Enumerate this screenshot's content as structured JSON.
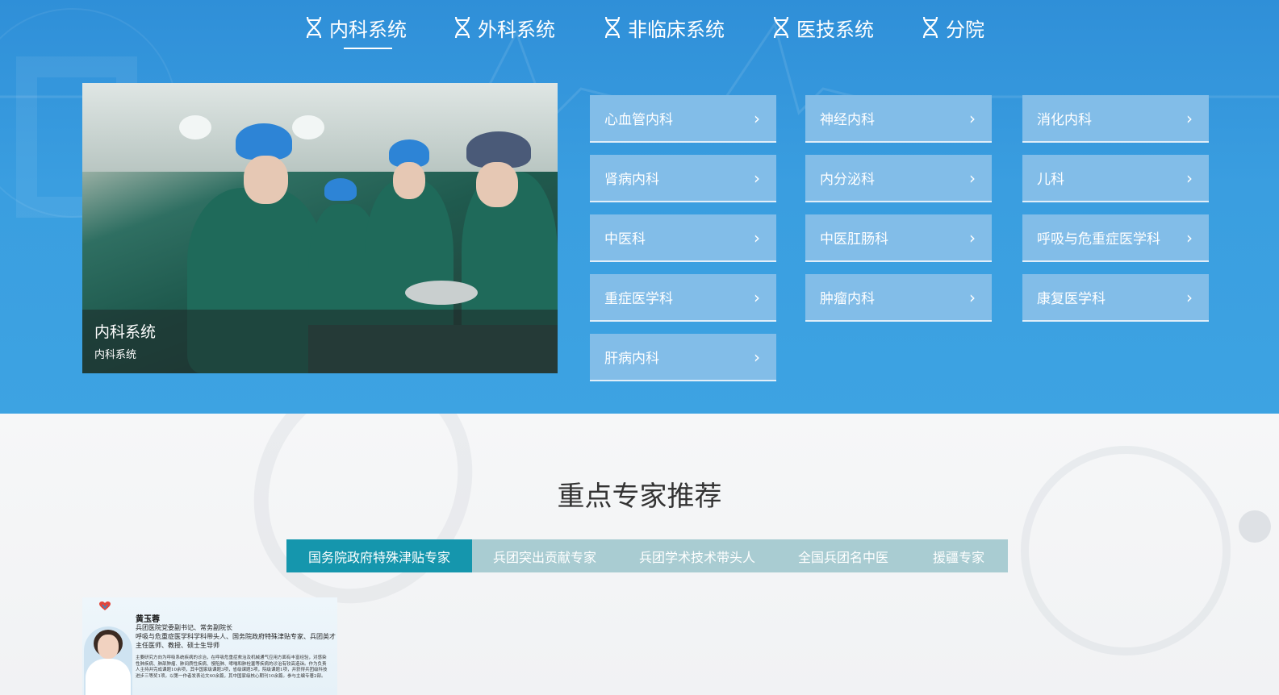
{
  "nav": {
    "tabs": [
      {
        "label": "内科系统",
        "active": true,
        "icon": "dna-icon"
      },
      {
        "label": "外科系统",
        "active": false,
        "icon": "dna-icon"
      },
      {
        "label": "非临床系统",
        "active": false,
        "icon": "dna-icon"
      },
      {
        "label": "医技系统",
        "active": false,
        "icon": "dna-icon"
      },
      {
        "label": "分院",
        "active": false,
        "icon": "dna-icon"
      }
    ]
  },
  "feature": {
    "caption_title": "内科系统",
    "caption_sub": "内科系统"
  },
  "departments": [
    {
      "label": "心血管内科",
      "icon": "chevron-right-icon"
    },
    {
      "label": "神经内科",
      "icon": "chevron-right-icon"
    },
    {
      "label": "消化内科",
      "icon": "chevron-right-icon"
    },
    {
      "label": "肾病内科",
      "icon": "chevron-right-icon"
    },
    {
      "label": "内分泌科",
      "icon": "chevron-right-icon"
    },
    {
      "label": "儿科",
      "icon": "chevron-right-icon"
    },
    {
      "label": "中医科",
      "icon": "chevron-right-icon"
    },
    {
      "label": "中医肛肠科",
      "icon": "chevron-right-icon"
    },
    {
      "label": "呼吸与危重症医学科",
      "icon": "chevron-right-icon"
    },
    {
      "label": "重症医学科",
      "icon": "chevron-right-icon"
    },
    {
      "label": "肿瘤内科",
      "icon": "chevron-right-icon"
    },
    {
      "label": "康复医学科",
      "icon": "chevron-right-icon"
    },
    {
      "label": "肝病内科",
      "icon": "chevron-right-icon"
    }
  ],
  "chevron_glyph": "›",
  "experts": {
    "title": "重点专家推荐",
    "tabs": [
      {
        "label": "国务院政府特殊津贴专家",
        "active": true
      },
      {
        "label": "兵团突出贡献专家",
        "active": false
      },
      {
        "label": "兵团学术技术带头人",
        "active": false
      },
      {
        "label": "全国兵团名中医",
        "active": false
      },
      {
        "label": "援疆专家",
        "active": false
      }
    ],
    "card": {
      "name": "黄玉蓉",
      "line1": "兵团医院党委副书记、常务副院长",
      "line2": "呼吸与危重症医学科学科带头人、国务院政府特殊津贴专家、兵团英才",
      "line3": "主任医师、教授、硕士生导师",
      "bio": "主要研究方向为呼吸系统疾病的诊治，在呼吸危重症救治及机械通气应用方面有丰富经验，对感染性肺疾病、肺部肿瘤、肺间质性疾病、慢阻肺、哮喘和肺栓塞等疾病的诊治有较高造诣。作为负责人主持并完成课题10余项，其中国家级课题3项，省级课题5项，院级课题1项，并获得兵团级科技进步三等奖1项。以第一作者发表论文40余篇，其中国家级核心期刊10余篇。参与主编专著2部。"
    }
  },
  "colors": {
    "top_bg": "#3a9ee0",
    "dept_button": "#82bde8",
    "tab_active": "#1596ad",
    "tab_inactive": "#a9ccd2"
  }
}
